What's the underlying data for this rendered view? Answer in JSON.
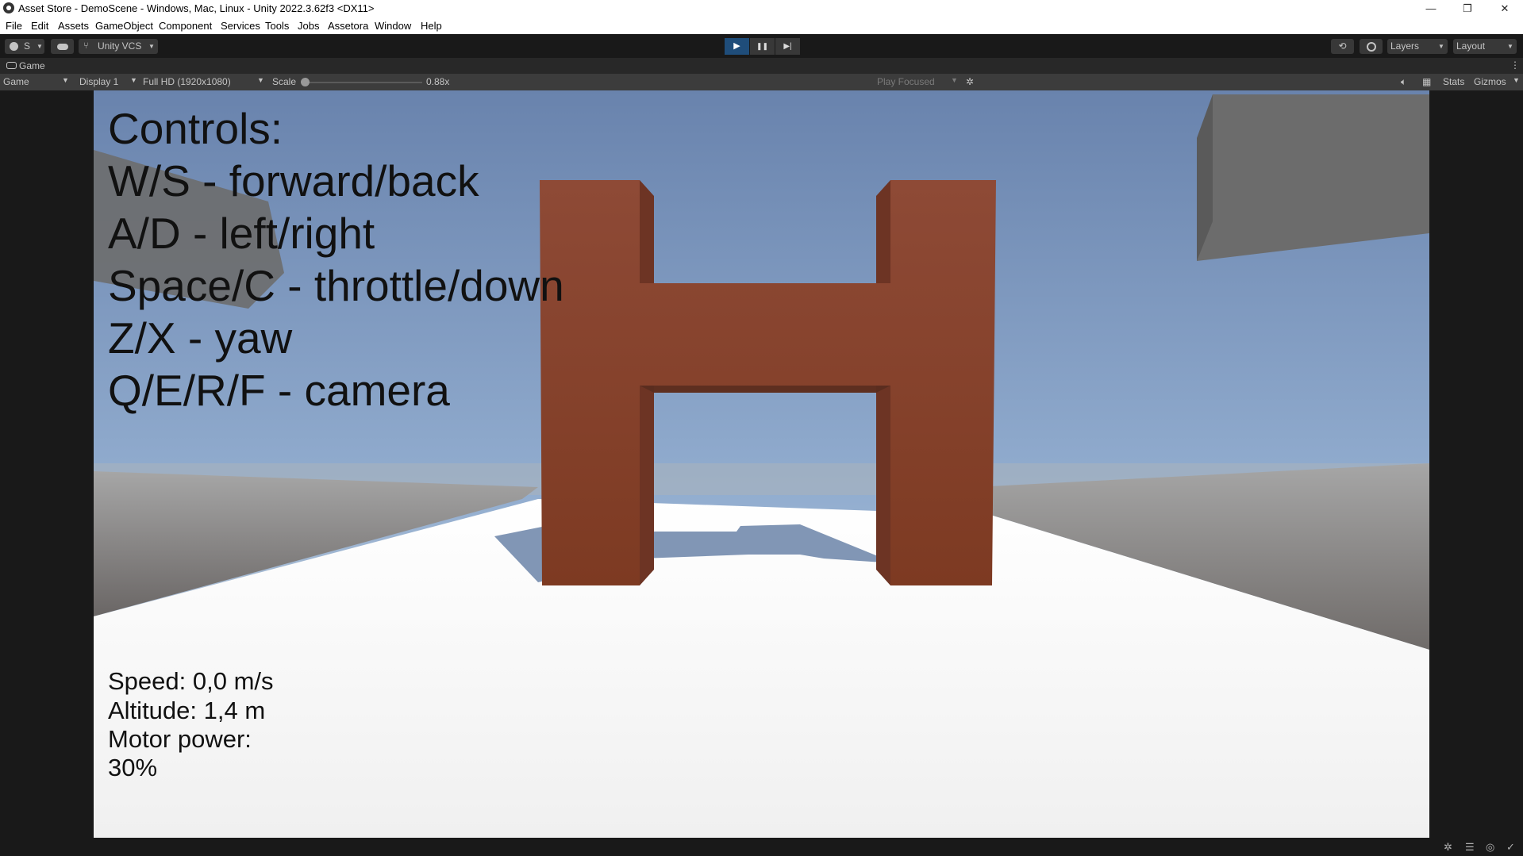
{
  "window": {
    "title": "Asset Store - DemoScene - Windows, Mac, Linux - Unity 2022.3.62f3 <DX11>",
    "minimize": "—",
    "maximize": "❐",
    "close": "✕"
  },
  "menu": [
    "File",
    "Edit",
    "Assets",
    "GameObject",
    "Component",
    "Services",
    "Tools",
    "Jobs",
    "Assetora",
    "Window",
    "Help"
  ],
  "toolbar": {
    "account_label": "S",
    "vcs_label": "Unity VCS",
    "play_icon": "▶",
    "pause_icon": "❚❚",
    "step_icon": "▶|",
    "layers_label": "Layers",
    "layout_label": "Layout"
  },
  "game_tab": {
    "label": "Game"
  },
  "game_toolbar": {
    "view_select": "Game",
    "display_select": "Display 1",
    "resolution_select": "Full HD (1920x1080)",
    "scale_label": "Scale",
    "scale_value": "0.88x",
    "scale_level": 0.0,
    "play_mode_select": "Play Focused",
    "stats_label": "Stats",
    "gizmos_label": "Gizmos"
  },
  "hud": {
    "controls_title": "Controls:",
    "controls": [
      "W/S - forward/back",
      "A/D - left/right",
      "Space/C - throttle/down",
      "Z/X - yaw",
      "Q/E/R/F - camera"
    ],
    "speed": "Speed: 0,0 m/s",
    "altitude": "Altitude: 1,4 m",
    "motor_power_label": "Motor power:",
    "motor_power_value": "30%"
  },
  "colors": {
    "editor_dark": "#191919",
    "toolbar_gray": "#3c3c3c",
    "play_active": "#1f4d7a",
    "gate_orange": "#8b4530",
    "sky_top": "#6b87b0",
    "ground": "#f5f5f5"
  }
}
